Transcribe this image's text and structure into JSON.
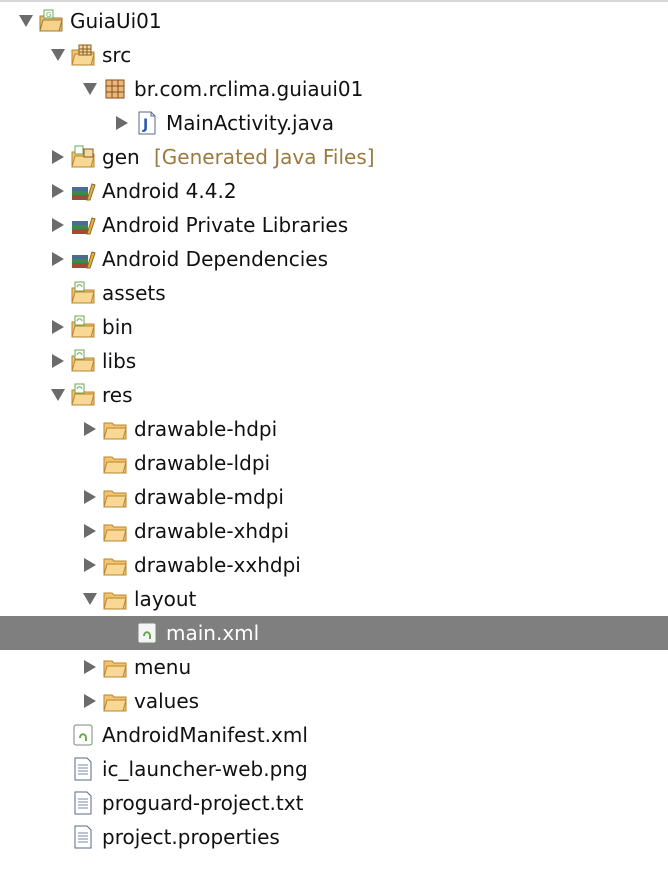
{
  "tree": {
    "rows": [
      {
        "label": "GuiaUi01",
        "decoration": "",
        "depth": 0,
        "state": "expanded",
        "icon": "project-icon"
      },
      {
        "label": "src",
        "decoration": "",
        "depth": 1,
        "state": "expanded",
        "icon": "source-folder-icon"
      },
      {
        "label": "br.com.rclima.guiaui01",
        "decoration": "",
        "depth": 2,
        "state": "expanded",
        "icon": "package-icon"
      },
      {
        "label": "MainActivity.java",
        "decoration": "",
        "depth": 3,
        "state": "collapsed",
        "icon": "java-file-icon"
      },
      {
        "label": "gen",
        "decoration": "[Generated Java Files]",
        "depth": 1,
        "state": "collapsed",
        "icon": "gen-folder-icon"
      },
      {
        "label": "Android 4.4.2",
        "decoration": "",
        "depth": 1,
        "state": "collapsed",
        "icon": "library-icon"
      },
      {
        "label": "Android Private Libraries",
        "decoration": "",
        "depth": 1,
        "state": "collapsed",
        "icon": "library-icon"
      },
      {
        "label": "Android Dependencies",
        "decoration": "",
        "depth": 1,
        "state": "collapsed",
        "icon": "library-icon"
      },
      {
        "label": "assets",
        "decoration": "",
        "depth": 1,
        "state": "none",
        "icon": "android-folder-icon"
      },
      {
        "label": "bin",
        "decoration": "",
        "depth": 1,
        "state": "collapsed",
        "icon": "android-folder-icon"
      },
      {
        "label": "libs",
        "decoration": "",
        "depth": 1,
        "state": "collapsed",
        "icon": "android-folder-icon"
      },
      {
        "label": "res",
        "decoration": "",
        "depth": 1,
        "state": "expanded",
        "icon": "android-folder-icon"
      },
      {
        "label": "drawable-hdpi",
        "decoration": "",
        "depth": 2,
        "state": "collapsed",
        "icon": "folder-icon"
      },
      {
        "label": "drawable-ldpi",
        "decoration": "",
        "depth": 2,
        "state": "none",
        "icon": "folder-icon"
      },
      {
        "label": "drawable-mdpi",
        "decoration": "",
        "depth": 2,
        "state": "collapsed",
        "icon": "folder-icon"
      },
      {
        "label": "drawable-xhdpi",
        "decoration": "",
        "depth": 2,
        "state": "collapsed",
        "icon": "folder-icon"
      },
      {
        "label": "drawable-xxhdpi",
        "decoration": "",
        "depth": 2,
        "state": "collapsed",
        "icon": "folder-icon"
      },
      {
        "label": "layout",
        "decoration": "",
        "depth": 2,
        "state": "expanded",
        "icon": "folder-icon"
      },
      {
        "label": "main.xml",
        "decoration": "",
        "depth": 3,
        "state": "none",
        "icon": "xml-file-icon",
        "selected": true
      },
      {
        "label": "menu",
        "decoration": "",
        "depth": 2,
        "state": "collapsed",
        "icon": "folder-icon"
      },
      {
        "label": "values",
        "decoration": "",
        "depth": 2,
        "state": "collapsed",
        "icon": "folder-icon"
      },
      {
        "label": "AndroidManifest.xml",
        "decoration": "",
        "depth": 1,
        "state": "none",
        "icon": "xml-file-icon"
      },
      {
        "label": "ic_launcher-web.png",
        "decoration": "",
        "depth": 1,
        "state": "none",
        "icon": "text-file-icon"
      },
      {
        "label": "proguard-project.txt",
        "decoration": "",
        "depth": 1,
        "state": "none",
        "icon": "text-file-icon"
      },
      {
        "label": "project.properties",
        "decoration": "",
        "depth": 1,
        "state": "none",
        "icon": "text-file-icon"
      }
    ]
  },
  "colors": {
    "selection": "#7f7f7f",
    "folder": "#f0c070",
    "decoration": "#9a7a40",
    "android_green": "#6aa84f"
  }
}
